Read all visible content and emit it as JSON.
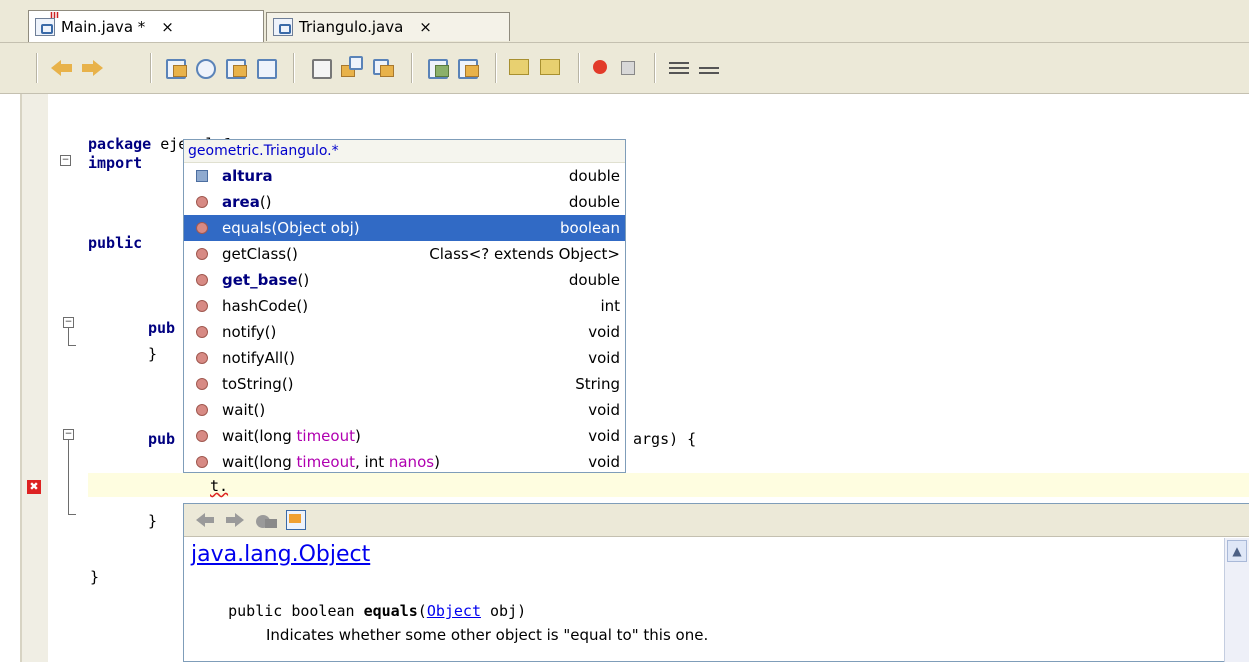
{
  "tabs": [
    {
      "label": "Main.java *",
      "close": "×",
      "active": true
    },
    {
      "label": "Triangulo.java",
      "close": "×",
      "active": false
    }
  ],
  "toolbar": {
    "icons": [
      "back-icon",
      "forward-icon",
      "find-previous-icon",
      "find-icon",
      "find-next-icon",
      "toggle-highlight-icon",
      "previous-bookmark-icon",
      "next-bookmark-icon",
      "toggle-bookmark-icon",
      "shift-left-icon",
      "shift-right-icon",
      "comment-icon",
      "uncomment-icon",
      "start-macro-icon",
      "stop-macro-icon",
      "format-icon",
      "diff-icon"
    ]
  },
  "code": {
    "line1_kw": "package",
    "line1_rest": " ejemplo1;",
    "line2_kw": "import",
    "line3_kw": "public",
    "line4_kw": "pub",
    "line5": "}",
    "line6_kw": "pub",
    "line6_rest": "args) {",
    "line7": "t.",
    "line8": "}",
    "line9": "}"
  },
  "completion": {
    "header": "geometric.Triangulo.*",
    "items": [
      {
        "kind": "field",
        "name": "altura",
        "params": "",
        "bold": true,
        "type": "double",
        "selected": false
      },
      {
        "kind": "method",
        "name": "area",
        "params": "()",
        "bold": true,
        "type": "double",
        "selected": false
      },
      {
        "kind": "method",
        "name": "equals",
        "params": "(Object obj)",
        "bold": false,
        "type": "boolean",
        "selected": true
      },
      {
        "kind": "method",
        "name": "getClass",
        "params": "()",
        "bold": false,
        "type": "Class<? extends Object>",
        "selected": false
      },
      {
        "kind": "method",
        "name": "get_base",
        "params": "()",
        "bold": true,
        "type": "double",
        "selected": false
      },
      {
        "kind": "method",
        "name": "hashCode",
        "params": "()",
        "bold": false,
        "type": "int",
        "selected": false
      },
      {
        "kind": "method",
        "name": "notify",
        "params": "()",
        "bold": false,
        "type": "void",
        "selected": false
      },
      {
        "kind": "method",
        "name": "notifyAll",
        "params": "()",
        "bold": false,
        "type": "void",
        "selected": false
      },
      {
        "kind": "method",
        "name": "toString",
        "params": "()",
        "bold": false,
        "type": "String",
        "selected": false
      },
      {
        "kind": "method",
        "name": "wait",
        "params": "()",
        "bold": false,
        "type": "void",
        "selected": false
      },
      {
        "kind": "method",
        "name": "wait",
        "params": "(long timeout)",
        "bold": false,
        "type": "void",
        "selected": false
      },
      {
        "kind": "method",
        "name": "wait",
        "params": "(long timeout, int nanos)",
        "bold": false,
        "type": "void",
        "selected": false
      }
    ]
  },
  "javadoc": {
    "class_link": "java.lang.Object",
    "sig_pre": "public boolean ",
    "sig_name": "equals",
    "sig_open": "(",
    "sig_type_link": "Object",
    "sig_post": " obj)",
    "description": "Indicates whether some other object is \"equal to\" this one."
  },
  "colors": {
    "selection": "#316ac5",
    "current_line": "#fefde0",
    "keyword": "#000080",
    "link": "#0000ee",
    "error": "#dd2222"
  }
}
